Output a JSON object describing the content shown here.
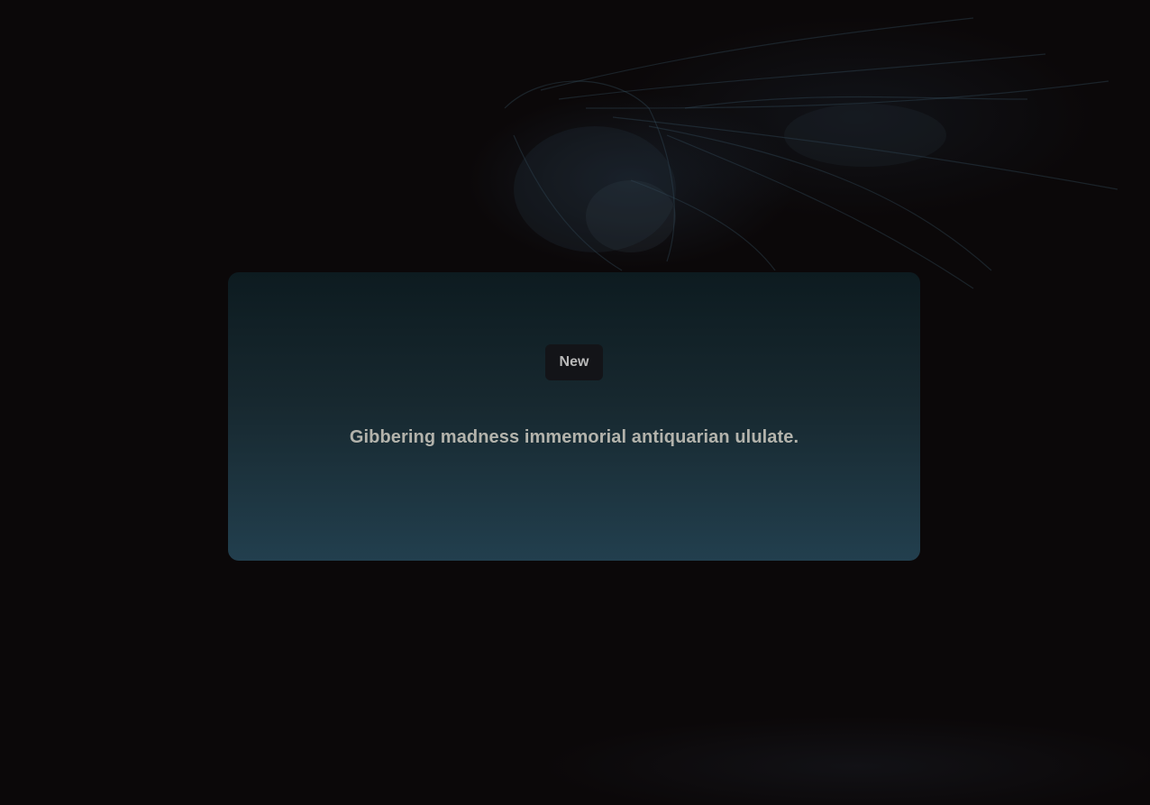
{
  "card": {
    "badge_label": "New",
    "message": "Gibbering madness immemorial antiquarian ululate."
  },
  "background": {
    "image": "jellyfish-photo",
    "tint": "#0b0809"
  },
  "colors": {
    "card_top": "#0d1b20",
    "card_bottom": "#223f4e",
    "badge_bg": "#131418",
    "text": "#b3b3ac"
  }
}
